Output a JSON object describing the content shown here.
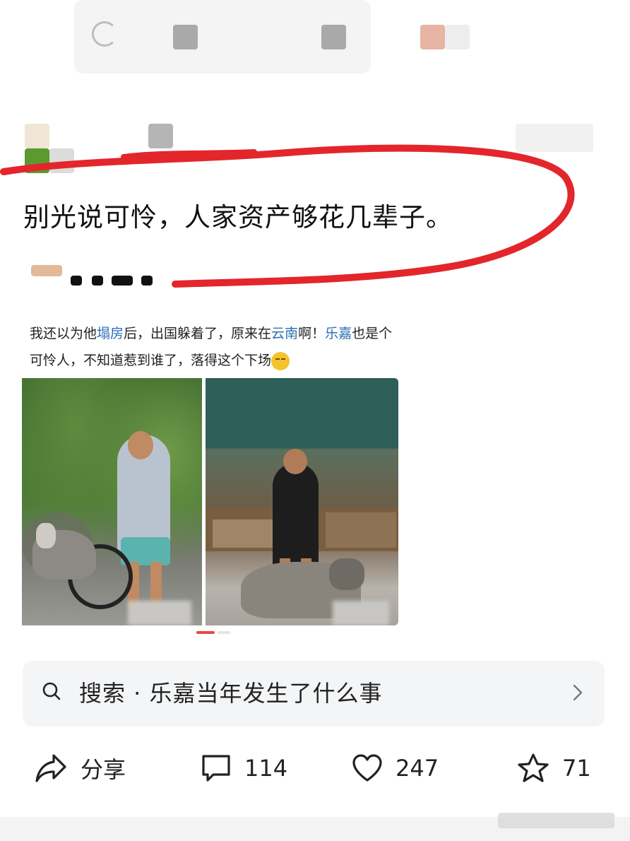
{
  "post": {
    "text": "别光说可怜，人家资产够花几辈子。"
  },
  "quoted_post": {
    "segments": [
      {
        "text": "我还以为他",
        "link": false
      },
      {
        "text": "塌房",
        "link": true
      },
      {
        "text": "后，出国躲着了，原来在",
        "link": false
      },
      {
        "text": "云南",
        "link": true
      },
      {
        "text": "啊！",
        "link": false
      },
      {
        "text": "乐嘉",
        "link": true
      },
      {
        "text": "也是个可怜人，不知道惹到谁了，落得这个下场",
        "link": false
      }
    ],
    "emoji": "smirk-emoji",
    "image_count": 2
  },
  "search": {
    "label": "搜索 · 乐嘉当年发生了什么事",
    "icon": "search-icon"
  },
  "actions": {
    "share_label": "分享",
    "comments": "114",
    "likes": "247",
    "favorites": "71"
  },
  "colors": {
    "link": "#2d6eb3",
    "annotation": "#e3262b",
    "carousel_active": "#e8483f"
  }
}
